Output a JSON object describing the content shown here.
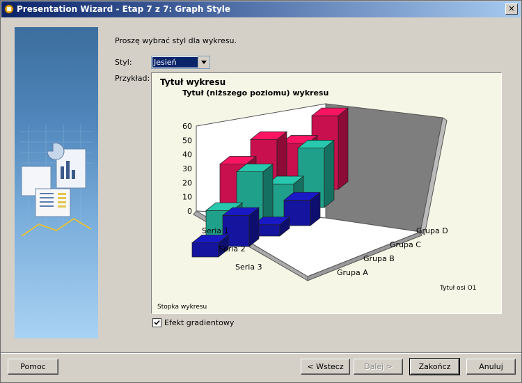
{
  "window": {
    "title": "Presentation Wizard - Etap 7 z 7: Graph Style",
    "close_glyph": "✕"
  },
  "prompt": "Proszę wybrać styl dla wykresu.",
  "style_label": "Styl:",
  "style_value": "Jesień",
  "preview_label": "Przykład:",
  "checkbox": {
    "label": "Efekt gradientowy",
    "checked": true
  },
  "buttons": {
    "help": "Pomoc",
    "back": "< Wstecz",
    "next": "Dalej >",
    "finish": "Zakończ",
    "cancel": "Anuluj"
  },
  "chart_data": {
    "type": "bar",
    "title": "Tytuł wykresu",
    "subtitle": "Tytuł (niższego poziomu) wykresu",
    "footer": "Stopka wykresu",
    "axis_title": "Tytuł osi O1",
    "categories": [
      "Grupa A",
      "Grupa B",
      "Grupa C",
      "Grupa D"
    ],
    "series": [
      {
        "name": "Seria 1",
        "color": "#c8104e",
        "values": [
          40,
          50,
          40,
          52
        ]
      },
      {
        "name": "Seria 2",
        "color": "#1fa08a",
        "values": [
          20,
          40,
          24,
          42
        ]
      },
      {
        "name": "Seria 3",
        "color": "#14149e",
        "values": [
          10,
          22,
          8,
          18
        ]
      }
    ],
    "y_ticks": [
      "0",
      "10",
      "20",
      "30",
      "40",
      "50",
      "60"
    ],
    "ylim": [
      0,
      60
    ]
  },
  "colors": {
    "title_bar_start": "#0a246a",
    "title_bar_end": "#a6caf0",
    "dialog": "#d4d0c8"
  }
}
